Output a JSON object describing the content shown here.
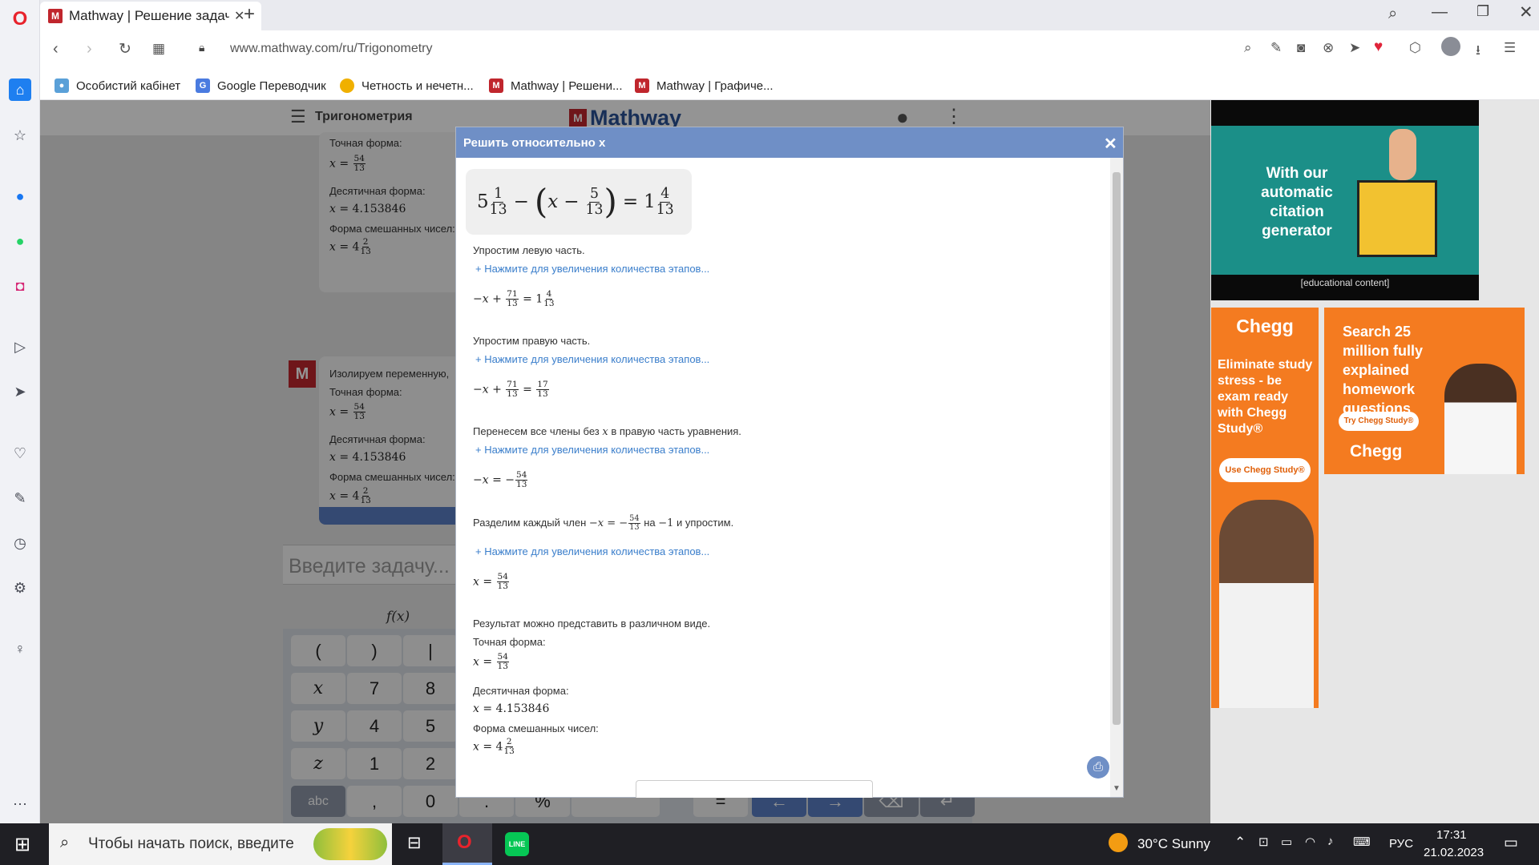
{
  "browser": {
    "tab_title": "Mathway | Решение задач",
    "url": "www.mathway.com/ru/Trigonometry",
    "bookmarks": [
      "Особистий кабінет",
      "Google Переводчик",
      "Четность и нечетн...",
      "Mathway | Решени...",
      "Mathway | Графиче..."
    ]
  },
  "site": {
    "menu_title": "Тригонометрия",
    "logo_text": "Mathway",
    "input_placeholder": "Введите задачу...",
    "fx_label": "f(x)",
    "bg_card1": {
      "exact_label": "Точная форма:",
      "decimal_label": "Десятичная форма:",
      "decimal_value": "4.153846",
      "mixed_label": "Форма смешанных чисел:"
    },
    "bg_card2": {
      "isolate_label": "Изолируем переменную,",
      "exact_label": "Точная форма:",
      "decimal_label": "Десятичная форма:",
      "decimal_value": "4.153846",
      "mixed_label": "Форма смешанных чисел:"
    },
    "keypad": [
      "(",
      ")",
      "|",
      "x",
      "7",
      "8",
      "y",
      "4",
      "5",
      "z",
      "1",
      "2",
      "abc",
      ",",
      "0",
      ".",
      "%",
      "="
    ]
  },
  "modal": {
    "title": "Решить относительно x",
    "close": "✕",
    "equation": {
      "whole1": "5",
      "num1": "1",
      "den1": "13",
      "var": "x",
      "num2": "5",
      "den2": "13",
      "whole3": "1",
      "num3": "4",
      "den3": "13"
    },
    "expand_link": "Нажмите для увеличения количества этапов...",
    "steps": [
      {
        "text": "Упростим левую часть.",
        "result": {
          "num": "71",
          "den": "13",
          "rhs_whole": "1",
          "rhs_num": "4",
          "rhs_den": "13"
        }
      },
      {
        "text": "Упростим правую часть.",
        "result": {
          "num": "71",
          "den": "13",
          "rhs_num": "17",
          "rhs_den": "13"
        }
      },
      {
        "text_before": "Перенесем все члены без",
        "text_var": "x",
        "text_after": "в правую часть уравнения.",
        "result": {
          "num": "54",
          "den": "13"
        }
      },
      {
        "text_before": "Разделим каждый член",
        "text_mid": "на",
        "text_neg": "−1",
        "text_after": "и упростим.",
        "result": {
          "num": "54",
          "den": "13"
        }
      }
    ],
    "result_intro": "Результат можно представить в различном виде.",
    "exact_label": "Точная форма:",
    "exact": {
      "num": "54",
      "den": "13"
    },
    "decimal_label": "Десятичная форма:",
    "decimal_value": "4.153846",
    "mixed_label": "Форма смешанных чисел:",
    "mixed": {
      "whole": "4",
      "num": "2",
      "den": "13"
    }
  },
  "ads": {
    "ad1_text": "With our automatic citation generator",
    "ad1_caption": "[educational content]",
    "ad2_brand": "Chegg",
    "ad2_text": "Eliminate study stress - be exam ready with Chegg Study®",
    "ad2_button": "Use Chegg Study®",
    "ad3_text": "Search 25 million fully explained homework questions",
    "ad3_button": "Try Chegg Study®",
    "ad3_brand": "Chegg"
  },
  "taskbar": {
    "search_placeholder": "Чтобы начать поиск, введите",
    "weather": "30°C  Sunny",
    "lang": "РУС",
    "time": "17:31",
    "date": "21.02.2023"
  },
  "colors": {
    "mathway_red": "#c0262d",
    "modal_header": "#6f8fc6",
    "link_blue": "#3a7ecb",
    "chegg_orange": "#f47b20"
  }
}
